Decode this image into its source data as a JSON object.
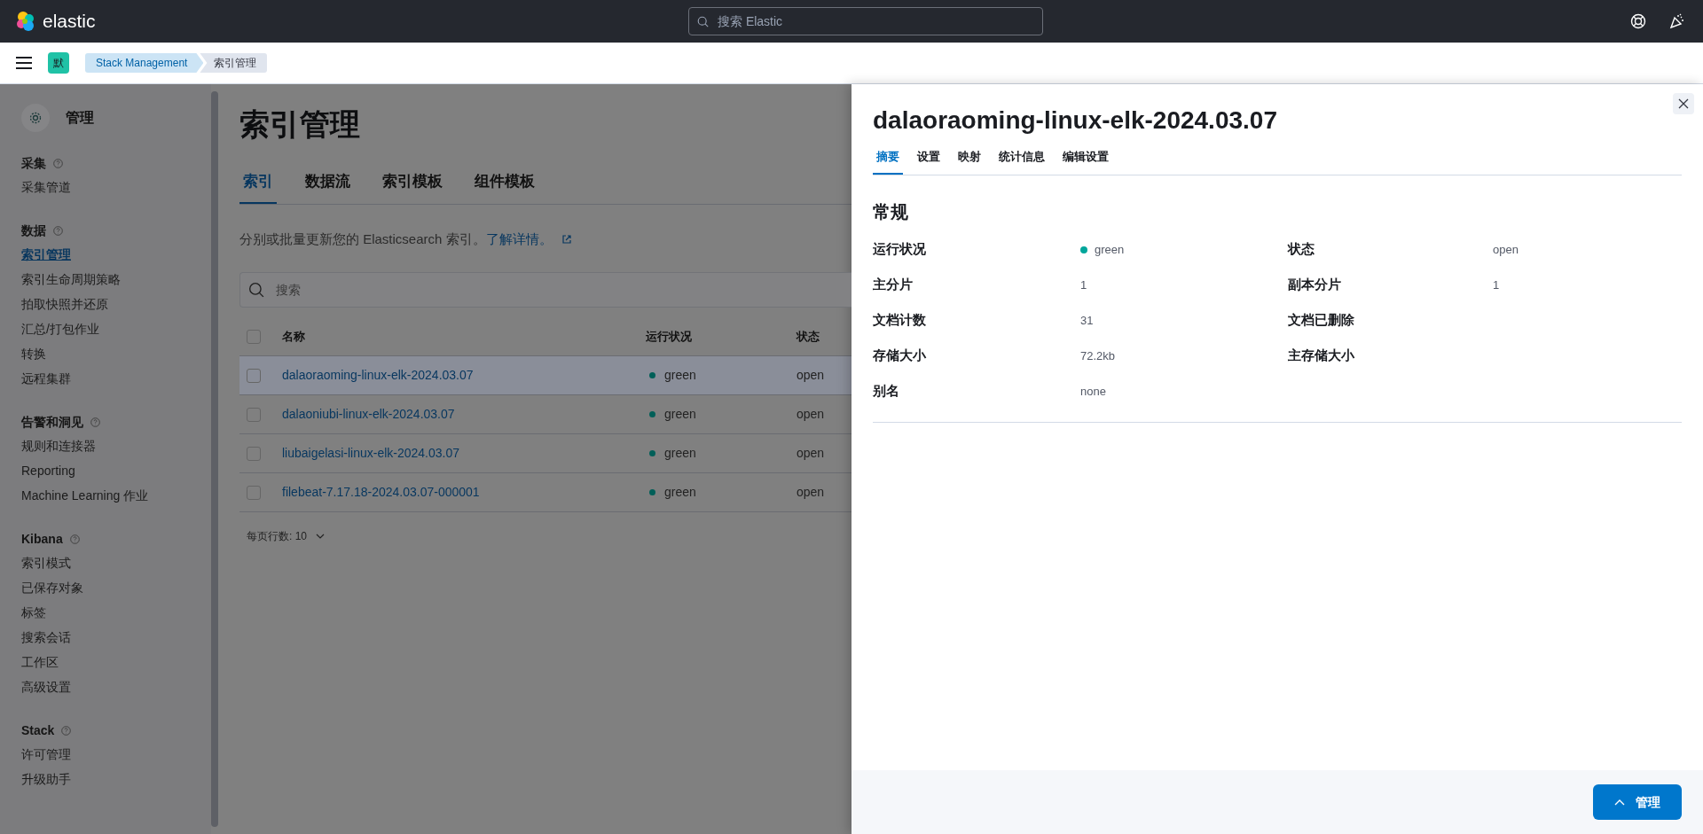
{
  "header": {
    "logo_text": "elastic",
    "search_placeholder": "搜索 Elastic"
  },
  "breadcrumb": {
    "space_badge": "默",
    "items": [
      "Stack Management",
      "索引管理"
    ]
  },
  "sidebar": {
    "title": "管理",
    "sections": [
      {
        "title": "采集",
        "items": [
          {
            "label": "采集管道",
            "selected": false
          }
        ]
      },
      {
        "title": "数据",
        "items": [
          {
            "label": "索引管理",
            "selected": true
          },
          {
            "label": "索引生命周期策略",
            "selected": false
          },
          {
            "label": "拍取快照并还原",
            "selected": false
          },
          {
            "label": "汇总/打包作业",
            "selected": false
          },
          {
            "label": "转换",
            "selected": false
          },
          {
            "label": "远程集群",
            "selected": false
          }
        ]
      },
      {
        "title": "告警和洞见",
        "items": [
          {
            "label": "规则和连接器",
            "selected": false
          },
          {
            "label": "Reporting",
            "selected": false
          },
          {
            "label": "Machine Learning 作业",
            "selected": false
          }
        ]
      },
      {
        "title": "Kibana",
        "items": [
          {
            "label": "索引模式",
            "selected": false
          },
          {
            "label": "已保存对象",
            "selected": false
          },
          {
            "label": "标签",
            "selected": false
          },
          {
            "label": "搜索会话",
            "selected": false
          },
          {
            "label": "工作区",
            "selected": false
          },
          {
            "label": "高级设置",
            "selected": false
          }
        ]
      },
      {
        "title": "Stack",
        "items": [
          {
            "label": "许可管理",
            "selected": false
          },
          {
            "label": "升级助手",
            "selected": false
          }
        ]
      }
    ]
  },
  "page": {
    "title": "索引管理",
    "tabs": [
      {
        "label": "索引",
        "selected": true
      },
      {
        "label": "数据流",
        "selected": false
      },
      {
        "label": "索引模板",
        "selected": false
      },
      {
        "label": "组件模板",
        "selected": false
      }
    ],
    "description": "分别或批量更新您的 Elasticsearch 索引。",
    "learn_more": "了解详情。",
    "search_placeholder": "搜索",
    "table": {
      "columns": [
        "名称",
        "运行状况",
        "状态"
      ],
      "select_all_checked": false,
      "rows": [
        {
          "name": "dalaoraoming-linux-elk-2024.03.07",
          "health": "green",
          "color": "#005f58",
          "status": "open",
          "checked": false,
          "selected": true
        },
        {
          "name": "dalaoniubi-linux-elk-2024.03.07",
          "health": "green",
          "color": "#005f58",
          "status": "open",
          "checked": false,
          "selected": false
        },
        {
          "name": "liubaigelasi-linux-elk-2024.03.07",
          "health": "green",
          "color": "#005f58",
          "status": "open",
          "checked": false,
          "selected": false
        },
        {
          "name": "filebeat-7.17.18-2024.03.07-000001",
          "health": "green",
          "color": "#005f58",
          "status": "open",
          "checked": false,
          "selected": false
        }
      ]
    },
    "rows_per_page": "每页行数: 10"
  },
  "flyout": {
    "title": "dalaoraoming-linux-elk-2024.03.07",
    "tabs": [
      {
        "label": "摘要",
        "selected": true
      },
      {
        "label": "设置",
        "selected": false
      },
      {
        "label": "映射",
        "selected": false
      },
      {
        "label": "统计信息",
        "selected": false
      },
      {
        "label": "编辑设置",
        "selected": false
      }
    ],
    "section_title": "常规",
    "fields": [
      {
        "label": "运行状况",
        "value": "green",
        "color": "#00a69b"
      },
      {
        "label": "状态",
        "value": "open"
      },
      {
        "label": "主分片",
        "value": "1"
      },
      {
        "label": "副本分片",
        "value": "1"
      },
      {
        "label": "文档计数",
        "value": "31"
      },
      {
        "label": "文档已删除"
      },
      {
        "label": "存储大小",
        "value": "72.2kb"
      },
      {
        "label": "主存储大小"
      },
      {
        "label": "别名",
        "value": "none"
      }
    ],
    "action_button": "管理"
  }
}
